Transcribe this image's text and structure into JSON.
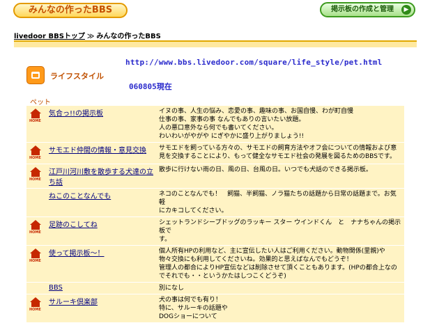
{
  "header": {
    "logo_text": "みんなの作ったBBS",
    "manage_button": "掲示板の作成と管理",
    "manage_arrow": "▶"
  },
  "breadcrumb": {
    "home": "livedoor BBSトップ",
    "separator": "≫",
    "current": "みんなの作ったBBS"
  },
  "url": "http://www.bbs.livedoor.com/square/life_style/pet.html",
  "category": {
    "label": "ライフスタイル",
    "date": "060805現在",
    "sub_label": "ペット"
  },
  "boards": [
    {
      "name": "気合っ!!の掲示板",
      "home": true,
      "desc": "イヌの事、人生の悩み、恋愛の事、趣味の事、お国自慢、わが町自慢\n仕事の事、家事の事 なんでもありの言いたい放題。\n人の悪口意外なら何でも書いてください。\nわいわいがやがや にぎやかに盛り上がりましょう!!"
    },
    {
      "name": "サモエド仲間の情報・意見交換",
      "home": true,
      "desc": "サモエドを飼っている方々の、サモエドの飼育方法やオフ会についての情報および意\n見を交換することにより、もって健全なサモエド社会の発展を図るためのBBSです。"
    },
    {
      "name": "江戸川河川敷を散歩する犬達の立ち話",
      "home": true,
      "desc": "散歩に行けない雨の日、風の日、台風の日。いつでも犬話のできる掲示板。"
    },
    {
      "name": "ねこのことなんでも",
      "home": false,
      "desc": "ネコのことなんでも！　飼猫、半飼猫、ノラ猫たちの話題から日常の話題まで。お気軽\nにカキコしてください。"
    },
    {
      "name": "足跡のこしてね",
      "home": true,
      "desc": "シェットランドシープドッグのラッキー スター ウインドくん　と　ナナちゃんの掲示板で\nす。"
    },
    {
      "name": "使って掲示板〜！",
      "home": true,
      "desc": "個人所有HPの利用など、主に宣伝したい人はご利用ください。動物関係(里親)や\n物々交換にも利用してくださいね。効果的と思えばなんでもどうぞ！\n管理人の都合によりHP宣伝などは削除させて頂くこともあります。(HPの都合上なの\nでそれでも・・というかたはしつこくどうぞ)"
    },
    {
      "name": "BBS",
      "home": false,
      "desc": "別になし"
    },
    {
      "name": "サルーキ倶楽部",
      "home": true,
      "desc": "犬の事は何でも有り！\n特に、サルーキの話題や\nDOGショーについて"
    }
  ]
}
